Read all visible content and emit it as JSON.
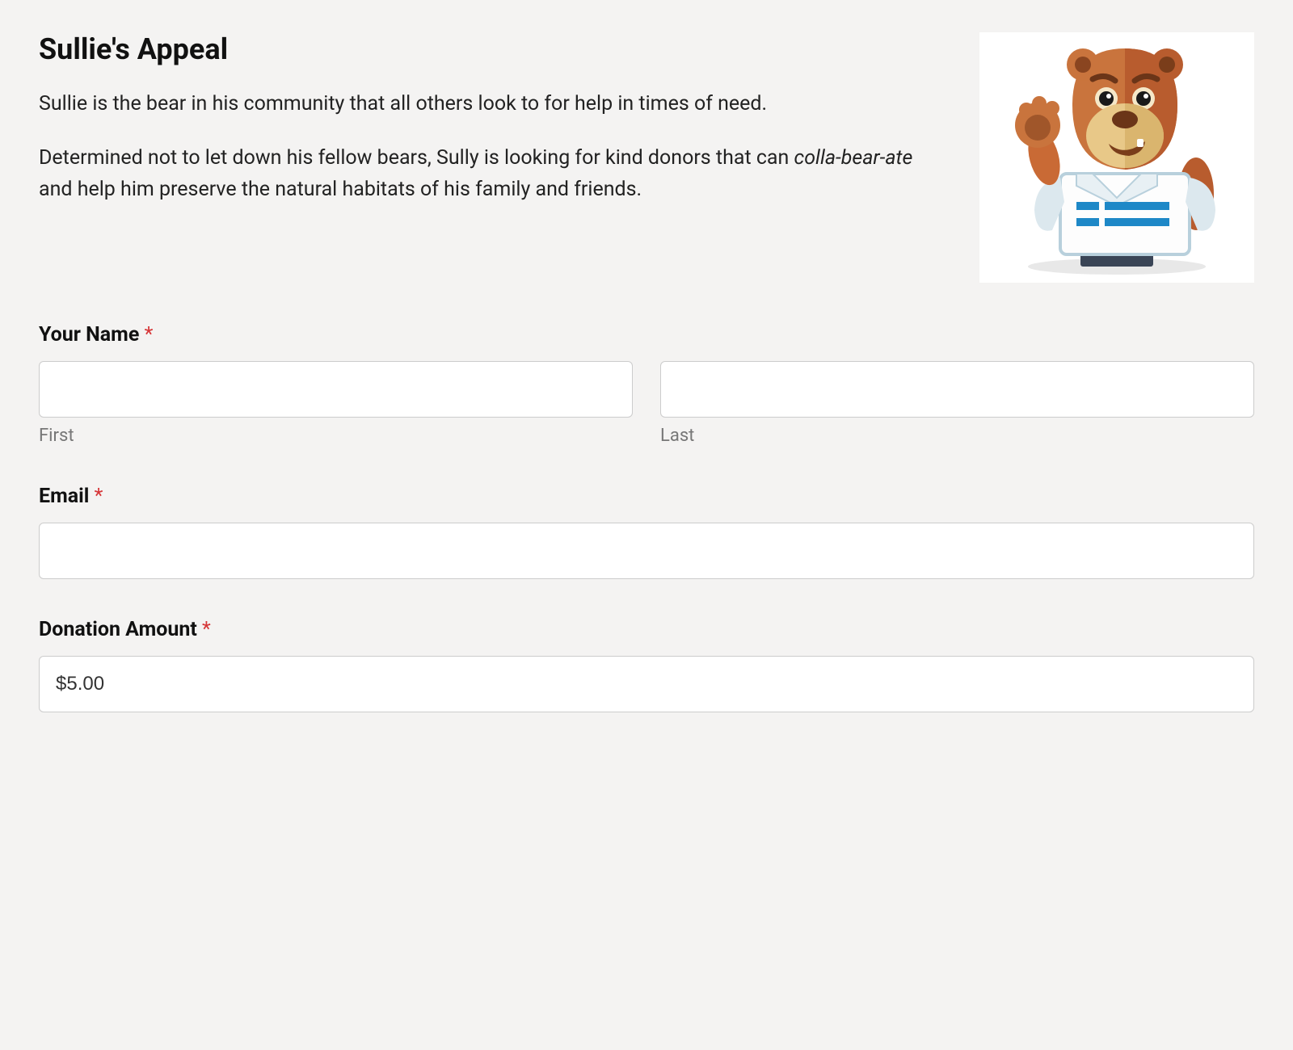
{
  "header": {
    "title": "Sullie's Appeal",
    "paragraph1": "Sullie is the bear in his community that all others look to for help in times of need.",
    "paragraph2_before": "Determined not to let down his fellow bears, Sully is looking for kind donors that can ",
    "paragraph2_italic": "colla-bear-ate",
    "paragraph2_after": " and help him preserve the natural habitats of his family and friends."
  },
  "form": {
    "name": {
      "label": "Your Name",
      "required_mark": "*",
      "first_sublabel": "First",
      "last_sublabel": "Last",
      "first_value": "",
      "last_value": ""
    },
    "email": {
      "label": "Email",
      "required_mark": "*",
      "value": ""
    },
    "donation": {
      "label": "Donation Amount",
      "required_mark": "*",
      "value": "$5.00"
    }
  }
}
